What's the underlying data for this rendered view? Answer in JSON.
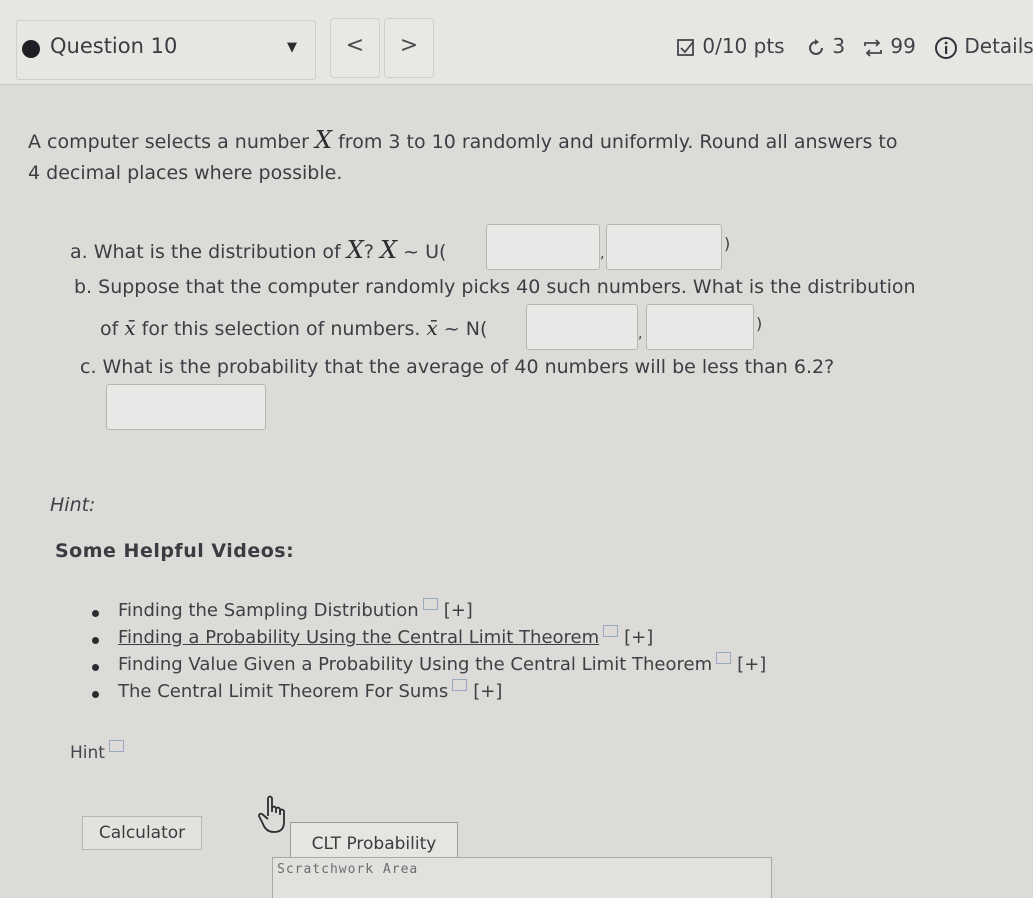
{
  "header": {
    "question_label": "Question 10",
    "prev_label": "<",
    "next_label": ">",
    "score": "0/10 pts",
    "attempts": "3",
    "retries": "99",
    "details_label": "Details"
  },
  "question": {
    "intro_line1_pre": "A computer selects a number ",
    "var_x": "X",
    "intro_line1_post": " from 3 to 10 randomly and uniformly. Round all answers to",
    "intro_line2": "4 decimal places where possible.",
    "part_a_pre": "a. What is the distribution of ",
    "part_a_post": "? ",
    "part_a_dist": " ~ U(",
    "part_b_line1": "b. Suppose that the computer randomly picks 40 such numbers.  What is the distribution",
    "part_b_line2_pre": "of ",
    "xbar": "x̄",
    "part_b_line2_post": " for this selection of numbers. ",
    "part_b_dist": " ~ N(",
    "part_c": "c. What is the probability that the average of 40 numbers will be less than 6.2?",
    "separator": ",",
    "close_paren": ")"
  },
  "hint_label": "Hint:",
  "videos_title": "Some Helpful Videos:",
  "videos": [
    {
      "label": "Finding the Sampling Distribution",
      "expand": "[+]"
    },
    {
      "label": "Finding a Probability Using the Central Limit Theorem",
      "expand": "[+]"
    },
    {
      "label": "Finding Value Given a Probability Using the Central Limit Theorem",
      "expand": "[+]"
    },
    {
      "label": "The Central Limit Theorem For Sums",
      "expand": "[+]"
    }
  ],
  "hint_link": "Hint",
  "calculator_label": "Calculator",
  "clt_label": "CLT Probability",
  "scratch_label": "Scratchwork Area"
}
